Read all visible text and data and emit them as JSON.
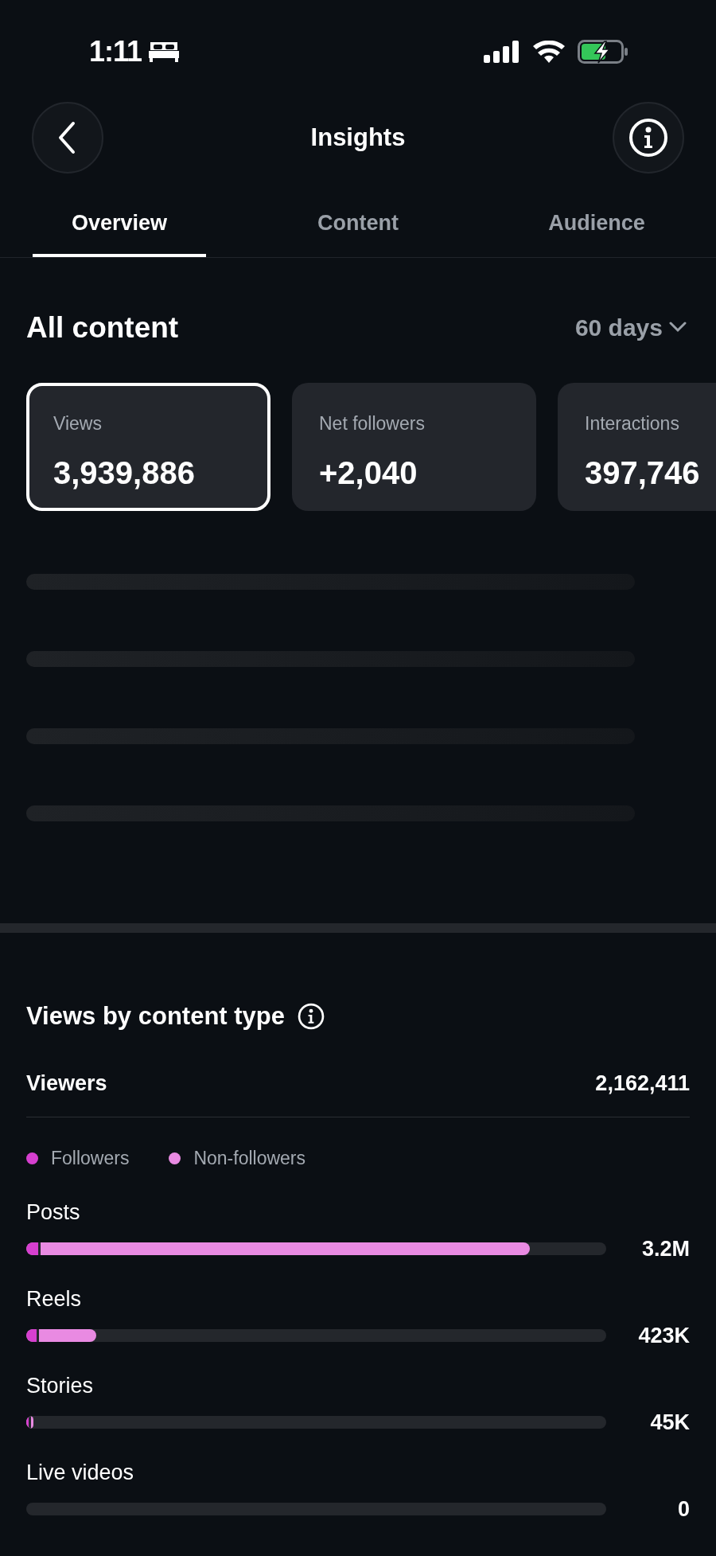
{
  "status_bar": {
    "time": "1:11"
  },
  "header": {
    "title": "Insights"
  },
  "tabs": [
    {
      "label": "Overview",
      "selected": true
    },
    {
      "label": "Content",
      "selected": false
    },
    {
      "label": "Audience",
      "selected": false
    }
  ],
  "section": {
    "title": "All content",
    "period": "60 days"
  },
  "metrics": [
    {
      "label": "Views",
      "value": "3,939,886",
      "selected": true
    },
    {
      "label": "Net followers",
      "value": "+2,040",
      "selected": false
    },
    {
      "label": "Interactions",
      "value": "397,746",
      "selected": false
    }
  ],
  "placeholders": [
    {
      "kind": "line"
    },
    {
      "kind": "line"
    },
    {
      "kind": "line"
    },
    {
      "kind": "line"
    }
  ],
  "views_by_type": {
    "title": "Views by content type",
    "viewers_label": "Viewers",
    "viewers_value": "2,162,411",
    "legend": [
      {
        "label": "Followers",
        "color": "#d63fcf"
      },
      {
        "label": "Non-followers",
        "color": "#e98ae2"
      }
    ],
    "rows": [
      {
        "label": "Posts",
        "value": "3.2M",
        "level": 0.868,
        "followers": {
          "level": 0.025
        }
      },
      {
        "label": "Reels",
        "value": "423K",
        "level": 0.121,
        "followers": {
          "level": 0.022
        }
      },
      {
        "label": "Stories",
        "value": "45K",
        "level": 0.013,
        "followers": {
          "level": 0.008
        }
      },
      {
        "label": "Live videos",
        "value": "0",
        "level": 0,
        "followers": {
          "level": 0
        }
      }
    ]
  }
}
